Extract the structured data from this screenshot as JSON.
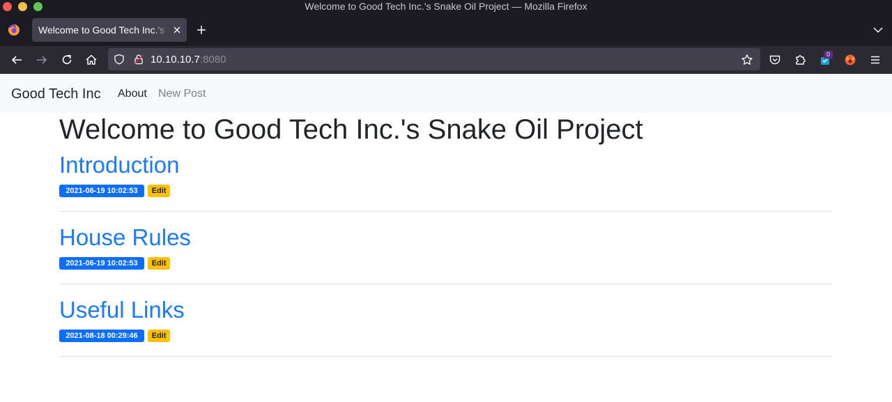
{
  "window": {
    "title": "Welcome to Good Tech Inc.'s Snake Oil Project — Mozilla Firefox"
  },
  "tabs": [
    {
      "label": "Welcome to Good Tech Inc.'s Snake Oil Project",
      "active": true
    }
  ],
  "toolbar": {
    "url_host": "10.10.10.7",
    "url_port": ":8080",
    "extension_badge": "0",
    "icons": [
      "back-icon",
      "forward-icon",
      "reload-icon",
      "home-icon",
      "shield-icon",
      "lock-icon",
      "star-icon",
      "pocket-icon",
      "extensions-icon",
      "wappalyzer-icon",
      "foxyproxy-icon",
      "menu-icon"
    ]
  },
  "site": {
    "brand": "Good Tech Inc",
    "nav": [
      {
        "label": "About",
        "active": true
      },
      {
        "label": "New Post",
        "active": false
      }
    ],
    "heading": "Welcome to Good Tech Inc.'s Snake Oil Project",
    "posts": [
      {
        "title": "Introduction",
        "date": "2021-06-19 10:02:53",
        "edit_label": "Edit"
      },
      {
        "title": "House Rules",
        "date": "2021-06-19 10:02:53",
        "edit_label": "Edit"
      },
      {
        "title": "Useful Links",
        "date": "2021-08-18 00:29:46",
        "edit_label": "Edit"
      }
    ]
  },
  "colors": {
    "link": "#1a7bf5",
    "date_badge": "#0d6efd",
    "edit_badge": "#ffc107",
    "chrome_dark": "#1c1b22",
    "toolbar": "#2b2a33"
  }
}
